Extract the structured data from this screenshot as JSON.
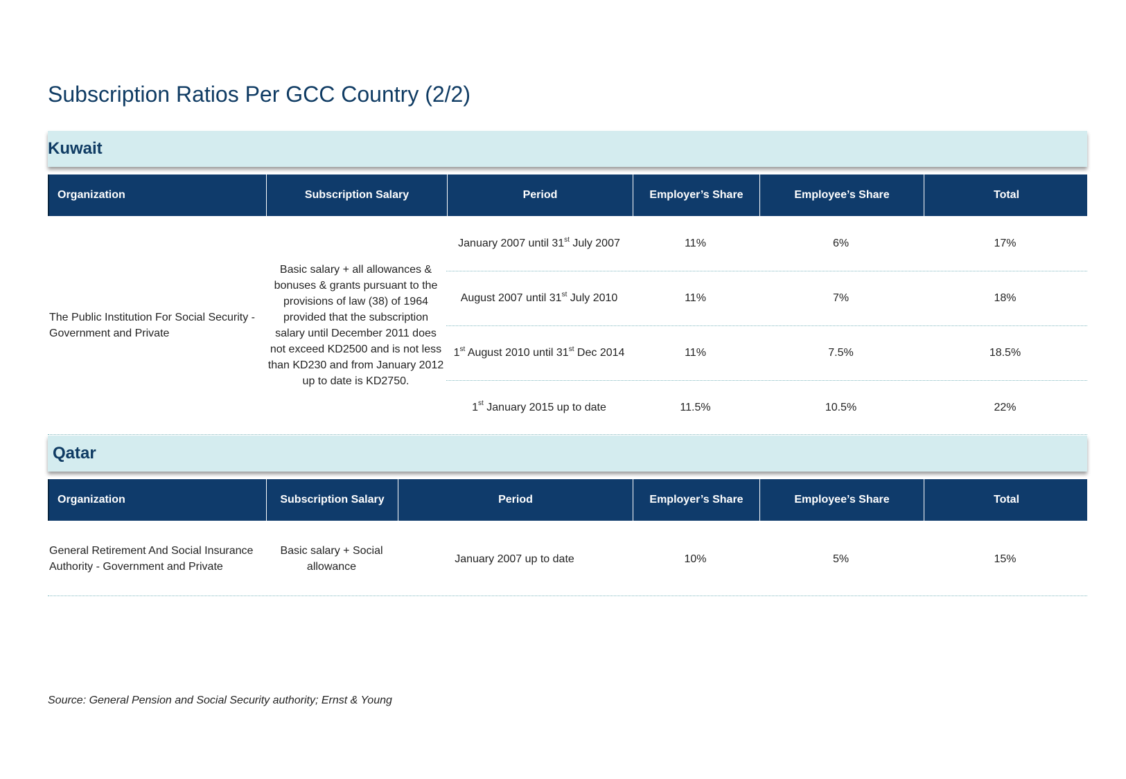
{
  "page_title": "Subscription Ratios Per GCC Country (2/2)",
  "source": "Source: General Pension and Social Security authority; Ernst & Young",
  "kuwait": {
    "section_label": "Kuwait",
    "headers": [
      "Organization",
      "Subscription Salary",
      "Period",
      "Employer’s Share",
      "Employee’s Share",
      "Total"
    ],
    "organization": "The Public Institution For Social Security - Government and Private",
    "subscription_salary": "Basic salary + all allowances & bonuses & grants pursuant to the provisions of law (38) of 1964 provided that the subscription salary until December 2011 does not exceed KD2500 and is not less than KD230 and from January 2012 up to date is KD2750.",
    "rows": [
      {
        "period_a": "January 2007 until 31",
        "period_sup1": "st",
        "period_b": " July 2007",
        "period_sup2": "",
        "period_c": "",
        "employer": "11%",
        "employee": "6%",
        "total": "17%"
      },
      {
        "period_a": "August 2007 until 31",
        "period_sup1": "st",
        "period_b": " July 2010",
        "period_sup2": "",
        "period_c": "",
        "employer": "11%",
        "employee": "7%",
        "total": "18%"
      },
      {
        "period_a": "1",
        "period_sup1": "st",
        "period_b": " August 2010 until 31",
        "period_sup2": "st",
        "period_c": " Dec 2014",
        "employer": "11%",
        "employee": "7.5%",
        "total": "18.5%"
      },
      {
        "period_a": "1",
        "period_sup1": "st",
        "period_b": " January 2015 up to date",
        "period_sup2": "",
        "period_c": "",
        "employer": "11.5%",
        "employee": "10.5%",
        "total": "22%"
      }
    ]
  },
  "qatar": {
    "section_label": "Qatar",
    "headers": [
      "Organization",
      "Subscription Salary",
      "Period",
      "Employer’s Share",
      "Employee’s Share",
      "Total"
    ],
    "organization": "General Retirement And Social Insurance Authority - Government and Private",
    "subscription_salary": "Basic salary + Social allowance",
    "period": "January 2007 up to date",
    "employer": "10%",
    "employee": "5%",
    "total": "15%"
  }
}
